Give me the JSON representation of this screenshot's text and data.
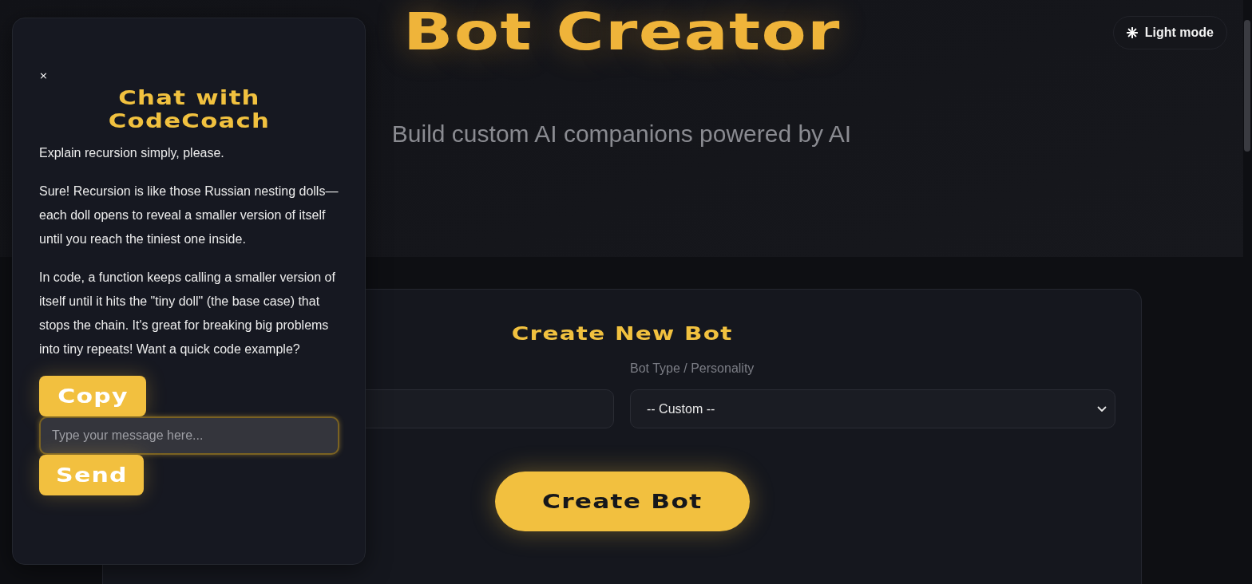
{
  "header": {
    "title": "Bot Creator",
    "subtitle": "Build custom AI companions powered by AI",
    "theme_toggle": {
      "label": "Light mode"
    }
  },
  "form": {
    "title": "Create New Bot",
    "fields": [
      {
        "kind": "text"
      },
      {
        "kind": "select",
        "label": "Bot Type / Personality",
        "value": "-- Custom --"
      }
    ],
    "submit": "Create Bot"
  },
  "chat": {
    "close": "×",
    "title": "Chat with CodeCoach",
    "messages": [
      "Explain recursion simply, please.",
      "Sure! Recursion is like those Russian nesting dolls—each doll opens to reveal a smaller version of itself until you reach the tiniest one inside.",
      "In code, a function keeps calling a smaller version of itself until it hits the \"tiny doll\" (the base case) that stops the chain. It's great for breaking big problems into tiny repeats! Want a quick code example?"
    ],
    "copy_button": "Copy",
    "input": {
      "placeholder": "Type your message here...",
      "focused": true
    },
    "send_button": "Send"
  }
}
